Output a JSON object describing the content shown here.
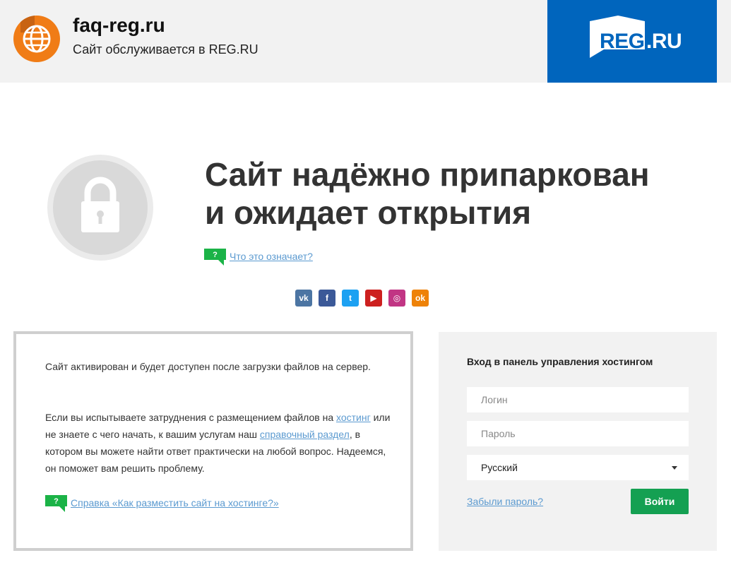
{
  "header": {
    "site_title": "faq-reg.ru",
    "site_subtitle": "Сайт обслуживается в REG.RU",
    "brand_reg": "REG",
    "brand_ru": ".RU"
  },
  "main": {
    "headline_line1": "Сайт надёжно припаркован",
    "headline_line2": "и ожидает открытия",
    "faq_link": "Что это означает?",
    "question_mark": "?"
  },
  "socials": [
    {
      "name": "vk",
      "glyph": "vk",
      "color": "#4c75a3"
    },
    {
      "name": "facebook",
      "glyph": "f",
      "color": "#3b5998"
    },
    {
      "name": "twitter",
      "glyph": "t",
      "color": "#1da1f2"
    },
    {
      "name": "youtube",
      "glyph": "▶",
      "color": "#cd201f"
    },
    {
      "name": "instagram",
      "glyph": "◎",
      "color": "#c13584"
    },
    {
      "name": "odnoklassniki",
      "glyph": "ok",
      "color": "#ee8208"
    }
  ],
  "info": {
    "p1": "Сайт активирован и будет доступен после загрузки файлов на сервер.",
    "p2_before": "Если вы испытываете затруднения с размещением файлов на ",
    "p2_link1": "хостинг",
    "p2_middle": " или не знаете с чего начать, к вашим услугам наш ",
    "p2_link2": "справочный раздел",
    "p2_after": ", в котором вы можете найти ответ практически на любой вопрос. Надеемся, он поможет вам решить проблему.",
    "help_link": "Справка «Как разместить сайт на хостинге?»"
  },
  "login": {
    "title": "Вход в панель управления хостингом",
    "login_placeholder": "Логин",
    "password_placeholder": "Пароль",
    "language": "Русский",
    "forgot": "Забыли пароль?",
    "submit": "Войти"
  },
  "colors": {
    "brand_blue": "#0065bd",
    "site_icon_orange": "#f07c16",
    "accent_green": "#14a052",
    "link_blue": "#5b9ad0"
  }
}
